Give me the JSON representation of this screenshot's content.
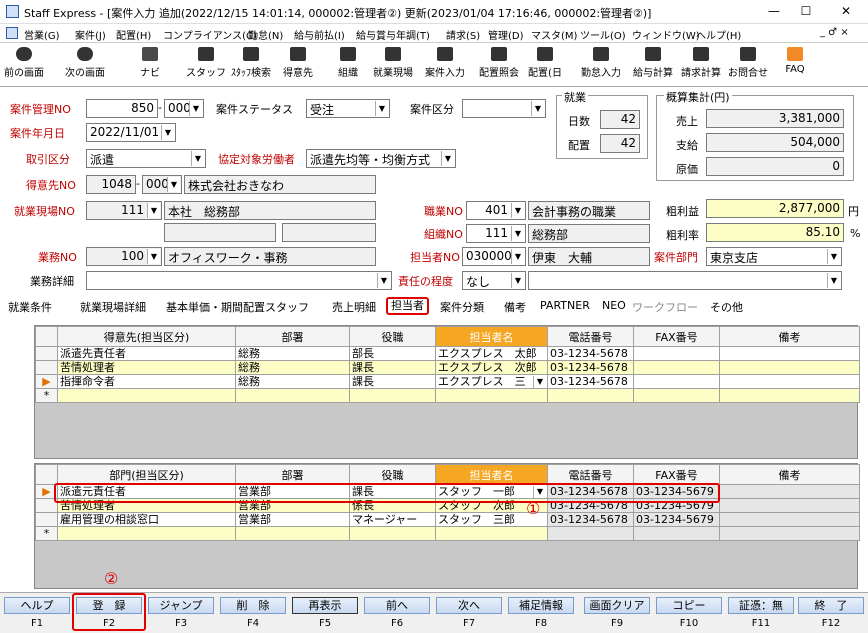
{
  "window": {
    "title": "Staff Express - [案件入力 追加(2022/12/15 14:01:14, 000002:管理者②) 更新(2023/01/04 17:16:46, 000002:管理者②)]",
    "min": "—",
    "max": "☐",
    "close": "✕"
  },
  "menu": [
    "営業(G)",
    "案件(J)",
    "配置(H)",
    "コンプライアンス(C)",
    "勤怠(N)",
    "給与前払(I)",
    "給与賞与年調(T)",
    "請求(S)",
    "管理(D)",
    "マスタ(M)",
    "ツール(O)",
    "ウィンドウ(W)",
    "ヘルプ(H)"
  ],
  "menu_right": "_ ♂ ×",
  "toolbar": [
    "前の画面",
    "次の画面",
    "ナビ",
    "スタッフ",
    "ｽﾀｯﾌ検索",
    "得意先",
    "組織",
    "就業現場",
    "案件入力",
    "配置照会",
    "配置(日",
    "勤怠入力",
    "給与計算",
    "請求計算",
    "お問合せ",
    "FAQ"
  ],
  "form": {
    "l_case_no": "案件管理NO",
    "case_no": "850",
    "case_sub": "000",
    "l_status": "案件ステータス",
    "status": "受注",
    "l_case_kbn": "案件区分",
    "case_kbn": "",
    "l_date": "案件年月日",
    "date": "2022/11/01",
    "l_torihiki": "取引区分",
    "torihiki": "派遣",
    "l_kyotei": "協定対象労働者",
    "kyotei": "派遣先均等・均衡方式",
    "l_tokuisaki": "得意先NO",
    "tokuisaki_no": "1048",
    "tokuisaki_sub": "000",
    "tokuisaki_name": "株式会社おきなわ",
    "l_genba": "就業現場NO",
    "genba_no": "111",
    "genba_name": "本社　総務部",
    "l_shokugyo": "職業NO",
    "shokugyo_no": "401",
    "shokugyo_name": "会計事務の職業",
    "l_soshiki": "組織NO",
    "soshiki_no": "111",
    "soshiki_name": "総務部",
    "l_gyomu": "業務NO",
    "gyomu_no": "100",
    "gyomu_name": "オフィスワーク・事務",
    "l_tanto": "担当者NO",
    "tanto_no": "030000",
    "tanto_name": "伊東　大輔",
    "l_bumon": "案件部門",
    "bumon": "東京支店",
    "l_gyomu_detail": "業務詳細",
    "gyomu_detail": "",
    "l_sekinin": "責任の程度",
    "sekinin": "なし",
    "sekinin2": ""
  },
  "shugyo": {
    "title": "就業",
    "l_days": "日数",
    "days": "42",
    "l_haichi": "配置",
    "haichi": "42"
  },
  "gaisan": {
    "title": "概算集計(円)",
    "l_uriage": "売上",
    "uriage": "3,381,000",
    "l_shikyu": "支給",
    "shikyu": "504,000",
    "l_genka": "原価",
    "genka": "0",
    "l_arari": "粗利益",
    "arari": "2,877,000",
    "arari_unit": "円",
    "l_ararir": "粗利率",
    "ararir": "85.10",
    "ararir_unit": "%"
  },
  "tabs": [
    "就業条件",
    "就業現場詳細",
    "基本単価・期間配置スタッフ",
    "売上明細",
    "担当者",
    "案件分類",
    "備考",
    "PARTNER",
    "NEO",
    "ワークフロー",
    "その他"
  ],
  "grid1": {
    "headers": [
      "得意先(担当区分)",
      "部署",
      "役職",
      "担当者名",
      "電話番号",
      "FAX番号",
      "備考"
    ],
    "rows": [
      [
        "派遣先責任者",
        "総務",
        "部長",
        "エクスプレス　太郎",
        "03-1234-5678",
        "",
        ""
      ],
      [
        "苦情処理者",
        "総務",
        "課長",
        "エクスプレス　次郎",
        "03-1234-5678",
        "",
        ""
      ],
      [
        "指揮命令者",
        "総務",
        "課長",
        "エクスプレス　三",
        "03-1234-5678",
        "",
        ""
      ]
    ]
  },
  "grid2": {
    "headers": [
      "部門(担当区分)",
      "部署",
      "役職",
      "担当者名",
      "電話番号",
      "FAX番号",
      "備考"
    ],
    "rows": [
      [
        "派遣元責任者",
        "営業部",
        "課長",
        "スタッフ　一郎",
        "03-1234-5678",
        "03-1234-5679",
        ""
      ],
      [
        "苦情処理者",
        "営業部",
        "係長",
        "スタッフ　次郎",
        "03-1234-5678",
        "03-1234-5679",
        ""
      ],
      [
        "雇用管理の相談窓口",
        "営業部",
        "マネージャー",
        "スタッフ　三郎",
        "03-1234-5678",
        "03-1234-5679",
        ""
      ]
    ]
  },
  "markers": {
    "m1": "①",
    "m2": "②",
    "star": "*",
    "arrow": "▶"
  },
  "fkeys": [
    [
      "ヘルプ",
      "F1"
    ],
    [
      "登　録",
      "F2"
    ],
    [
      "ジャンプ",
      "F3"
    ],
    [
      "削　除",
      "F4"
    ],
    [
      "再表示",
      "F5"
    ],
    [
      "前へ",
      "F6"
    ],
    [
      "次へ",
      "F7"
    ],
    [
      "補足情報",
      "F8"
    ],
    [
      "画面クリア",
      "F9"
    ],
    [
      "コピー",
      "F10"
    ],
    [
      "証憑：無",
      "F11"
    ],
    [
      "終　了",
      "F12"
    ]
  ]
}
